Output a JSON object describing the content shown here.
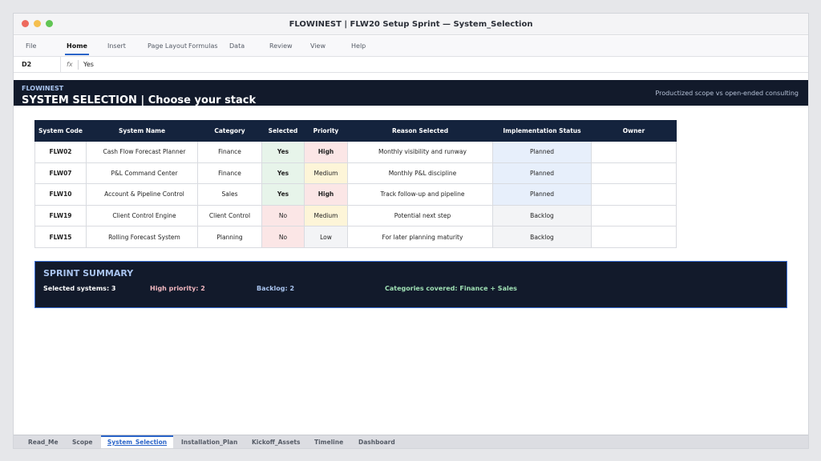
{
  "window": {
    "title": "FLOWINEST | FLW20 Setup Sprint — System_Selection"
  },
  "ribbon": {
    "tabs": [
      "File",
      "Home",
      "Insert",
      "Page Layout",
      "Formulas",
      "Data",
      "Review",
      "View",
      "Help"
    ],
    "active": "Home"
  },
  "formula_bar": {
    "cell_ref": "D2",
    "fx": "fx",
    "value": "Yes"
  },
  "banner": {
    "brand": "FLOWINEST",
    "headline": "SYSTEM SELECTION | Choose your stack",
    "tagline": "Productized scope vs open-ended consulting"
  },
  "table": {
    "headers": [
      "System Code",
      "System Name",
      "Category",
      "Selected",
      "Priority",
      "Reason Selected",
      "Implementation Status",
      "Owner"
    ],
    "rows": [
      {
        "code": "FLW02",
        "name": "Cash Flow Forecast Planner",
        "category": "Finance",
        "selected": "Yes",
        "priority": "High",
        "reason": "Monthly visibility and runway",
        "status": "Planned",
        "owner": ""
      },
      {
        "code": "FLW07",
        "name": "P&L Command Center",
        "category": "Finance",
        "selected": "Yes",
        "priority": "Medium",
        "reason": "Monthly P&L discipline",
        "status": "Planned",
        "owner": ""
      },
      {
        "code": "FLW10",
        "name": "Account & Pipeline Control",
        "category": "Sales",
        "selected": "Yes",
        "priority": "High",
        "reason": "Track follow-up and pipeline",
        "status": "Planned",
        "owner": ""
      },
      {
        "code": "FLW19",
        "name": "Client Control Engine",
        "category": "Client Control",
        "selected": "No",
        "priority": "Medium",
        "reason": "Potential next step",
        "status": "Backlog",
        "owner": ""
      },
      {
        "code": "FLW15",
        "name": "Rolling Forecast System",
        "category": "Planning",
        "selected": "No",
        "priority": "Low",
        "reason": "For later planning maturity",
        "status": "Backlog",
        "owner": ""
      }
    ]
  },
  "summary": {
    "title": "SPRINT SUMMARY",
    "selected": "Selected systems: 3",
    "high": "High priority: 2",
    "backlog": "Backlog: 2",
    "categories": "Categories covered: Finance + Sales"
  },
  "sheet_tabs": {
    "items": [
      "Read_Me",
      "Scope",
      "System_Selection",
      "Installation_Plan",
      "Kickoff_Assets",
      "Timeline",
      "Dashboard"
    ],
    "active": "System_Selection"
  },
  "colors": {
    "banner": "#121a2b",
    "header": "#14233d",
    "accent": "#2a64c8",
    "yes": "#1d6b33",
    "high": "#b41e1e",
    "summary_high": "#f2b8c0",
    "summary_backlog": "#a9c4ef",
    "summary_categories": "#9fe0b4"
  }
}
